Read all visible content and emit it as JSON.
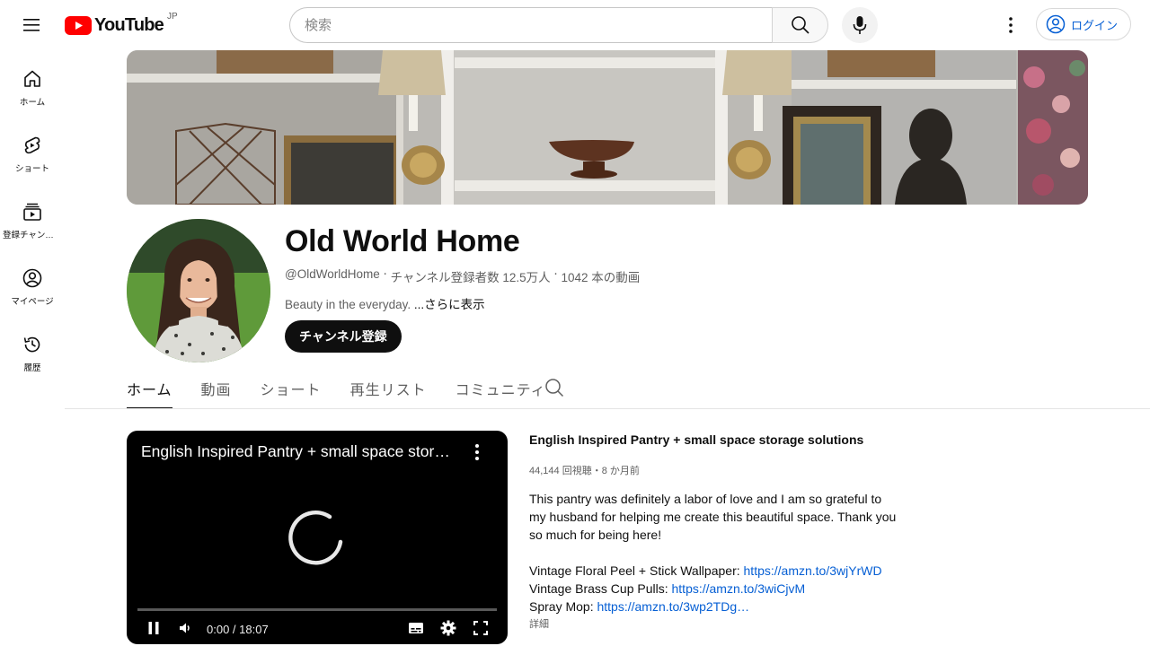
{
  "topbar": {
    "logo_text": "YouTube",
    "region": "JP",
    "search_placeholder": "検索",
    "login_label": "ログイン"
  },
  "sidenav": {
    "items": [
      {
        "label": "ホーム",
        "icon": "home-icon"
      },
      {
        "label": "ショート",
        "icon": "shorts-icon"
      },
      {
        "label": "登録チャンネル",
        "icon": "subscriptions-icon"
      },
      {
        "label": "マイページ",
        "icon": "you-icon"
      },
      {
        "label": "履歴",
        "icon": "history-icon"
      }
    ]
  },
  "channel": {
    "name": "Old World Home",
    "handle": "@OldWorldHome",
    "subscribers": "チャンネル登録者数 12.5万人",
    "videos": "1042 本の動画",
    "description": "Beauty in the everyday. ",
    "more_label": "...さらに表示",
    "subscribe_label": "チャンネル登録"
  },
  "tabs": [
    {
      "label": "ホーム",
      "active": true
    },
    {
      "label": "動画",
      "active": false
    },
    {
      "label": "ショート",
      "active": false
    },
    {
      "label": "再生リスト",
      "active": false
    },
    {
      "label": "コミュニティ",
      "active": false
    }
  ],
  "player": {
    "title": "English Inspired Pantry + small space storage solutions",
    "time": "0:00 / 18:07",
    "progress": 0
  },
  "video": {
    "title": "English Inspired Pantry + small space storage solutions",
    "meta": "44,144 回視聴・8 か月前",
    "description": "This pantry was definitely a labor of love and I am so grateful to my husband for helping me create this beautiful space. Thank you so much for being here!",
    "links": [
      {
        "label": "Vintage Floral Peel + Stick Wallpaper: ",
        "url": "https://amzn.to/3wjYrWD"
      },
      {
        "label": "Vintage Brass Cup Pulls: ",
        "url": "https://amzn.to/3wiCjvM"
      },
      {
        "label": "Spray Mop: ",
        "url": "https://amzn.to/3wp2TDg…"
      }
    ],
    "detail_label": "詳細"
  },
  "colors": {
    "brand_red": "#ff0000",
    "link_blue": "#065fd4",
    "text_secondary": "#606060"
  }
}
